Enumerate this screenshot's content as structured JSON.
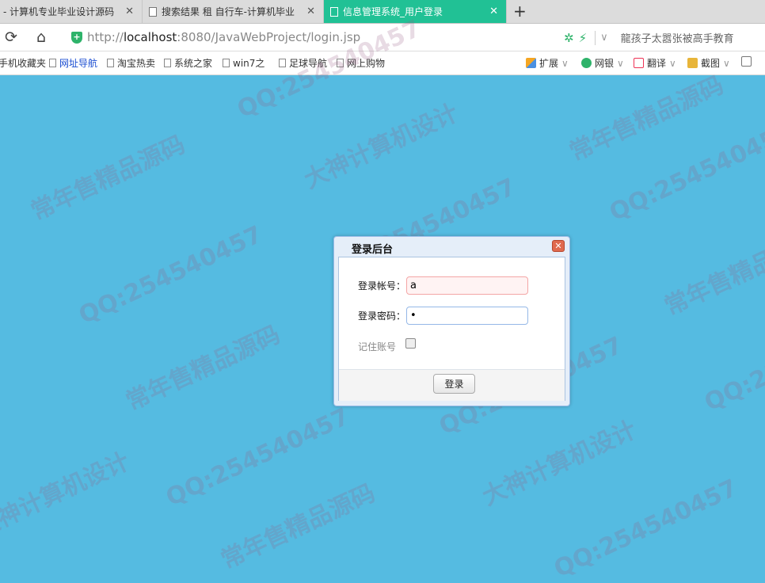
{
  "browser": {
    "tabs": [
      {
        "title": "- 计算机专业毕业设计源码",
        "active": false
      },
      {
        "title": "搜索结果 租 自行车-计算机毕业",
        "active": false
      },
      {
        "title": "信息管理系统_用户登录",
        "active": true
      }
    ],
    "new_tab": "+",
    "close_glyph": "✕",
    "url": {
      "scheme": "http://",
      "host": "localhost",
      "rest": ":8080/JavaWebProject/login.jsp"
    },
    "search_hint": "龍孩子太嚣张被高手教育",
    "bookmarks": [
      {
        "label": "手机收藏夹",
        "link": false
      },
      {
        "label": "网址导航",
        "link": true
      },
      {
        "label": "淘宝热卖",
        "link": false
      },
      {
        "label": "系统之家",
        "link": false
      },
      {
        "label": "win7之",
        "link": false
      },
      {
        "label": "足球导航",
        "link": false
      },
      {
        "label": "网上购物",
        "link": false
      }
    ],
    "bookmark_tools": [
      "扩展",
      "网银",
      "翻译",
      "截图"
    ],
    "icons": {
      "back": "refresh-icon",
      "home": "home-icon",
      "secure": "shield-icon"
    }
  },
  "watermark": {
    "texts": [
      "QQ:254540457",
      "常年售精品源码",
      "大神计算机设计"
    ]
  },
  "dialog": {
    "title": "登录后台",
    "account_label": "登录帐号：",
    "account_value": "a",
    "password_label": "登录密码：",
    "password_value": "a",
    "remember_label": "记住账号",
    "login_button": "登录"
  },
  "colors": {
    "page_bg": "#55bbe1",
    "active_tab": "#21c195",
    "dialog_border": "#99bbe8"
  }
}
